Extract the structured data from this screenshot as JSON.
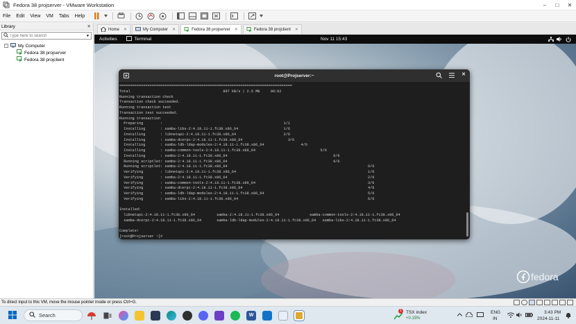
{
  "window": {
    "title": "Fedora 38 projserver - VMware Workstation"
  },
  "menu": [
    "File",
    "Edit",
    "View",
    "VM",
    "Tabs",
    "Help"
  ],
  "library": {
    "title": "Library",
    "search_placeholder": "Type here to search",
    "root": "My Computer",
    "vms": [
      "Fedora 38 projserver",
      "Fedora 38 projclient"
    ]
  },
  "tabs": [
    {
      "label": "Home",
      "active": false
    },
    {
      "label": "My Computer",
      "active": false
    },
    {
      "label": "Fedora 38 projserver",
      "active": true
    },
    {
      "label": "Fedora 38 projclient",
      "active": false
    }
  ],
  "gnome": {
    "activities": "Activities",
    "app": "Terminal",
    "clock": "Nov 11  15:43"
  },
  "terminal": {
    "title": "root@Projserver:~",
    "lines": [
      "================================================================================",
      "Total                                           897 kB/s | 2.5 MB     00:02",
      "Running transaction check",
      "Transaction check succeeded.",
      "Running transaction test",
      "Transaction test succeeded.",
      "Running transaction",
      "  Preparing        :                                                        1/1",
      "  Installing       : samba-libs-2:4.18.11-1.fc38.x86_64                     1/6",
      "  Installing       : libnetapi-2:4.18.11-1.fc38.x86_64                      2/6",
      "  Installing       : samba-dcerpc-2:4.18.11-1.fc38.x86_64                     3/6",
      "  Installing       : samba-ldb-ldap-modules-2:4.18.11-1.fc38.x86_64                 4/6",
      "  Installing       : samba-common-tools-2:4.18.11-1.fc38.x86_64                              5/6",
      "  Installing       : samba-2:4.18.11-1.fc38.x86_64                                                 6/6",
      "  Running scriptlet: samba-2:4.18.11-1.fc38.x86_64                                                 6/6",
      "  Running scriptlet: samba-2:4.18.11-1.fc38.x86_64                                                                 6/6",
      "  Verifying        : libnetapi-2:4.18.11-1.fc38.x86_64                                                             1/6",
      "  Verifying        : samba-2:4.18.11-1.fc38.x86_64                                                                 2/6",
      "  Verifying        : samba-common-tools-2:4.18.11-1.fc38.x86_64                                                    3/6",
      "  Verifying        : samba-dcerpc-2:4.18.11-1.fc38.x86_64                                                          4/6",
      "  Verifying        : samba-ldb-ldap-modules-2:4.18.11-1.fc38.x86_64                                                5/6",
      "  Verifying        : samba-libs-2:4.18.11-1.fc38.x86_64                                                            6/6",
      "",
      "Installed:",
      "  libnetapi-2:4.18.11-1.fc38.x86_64          samba-2:4.18.11-1.fc38.x86_64              samba-common-tools-2:4.18.11-1.fc38.x86_64",
      "  samba-dcerpc-2:4.18.11-1.fc38.x86_64       samba-ldb-ldap-modules-2:4.18.11-1.fc38.x86_64   samba-libs-2:4.18.11-1.fc38.x86_64",
      "",
      "Complete!",
      "[root@Projserver ~]# "
    ]
  },
  "desktop": {
    "logo": "fedora"
  },
  "statusbar": {
    "text": "To direct input to this VM, move the mouse pointer inside or press Ctrl+G."
  },
  "taskbar": {
    "search": "Search",
    "stock_name": "TSX index",
    "stock_change": "+0.15%",
    "stock_badge": "1",
    "lang": "ENG",
    "region": "IN",
    "time": "3:43 PM",
    "date": "2024-11-11"
  },
  "colors": {
    "taskbar": "#dfe7ef",
    "terminal_bg": "#1e1e1e",
    "accent": "#0067c0"
  }
}
